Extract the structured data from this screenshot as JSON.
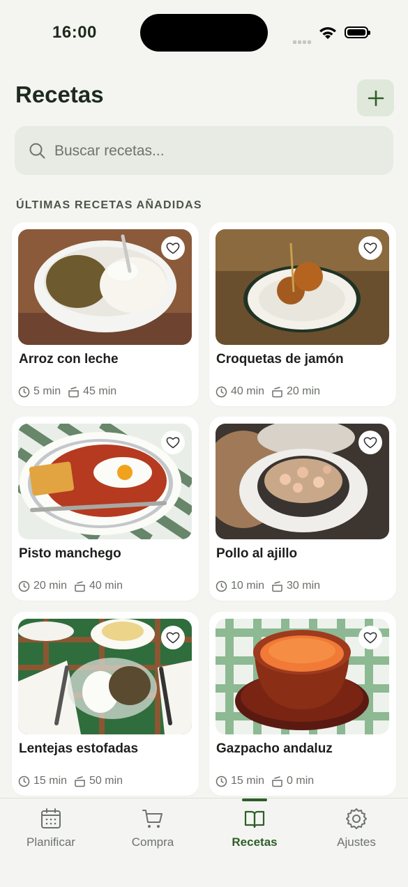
{
  "status": {
    "time": "16:00"
  },
  "header": {
    "title": "Recetas",
    "add_icon": "plus-icon"
  },
  "search": {
    "placeholder": "Buscar recetas...",
    "icon": "search-icon"
  },
  "section_title": "ÚLTIMAS RECETAS AÑADIDAS",
  "recipes": [
    {
      "name": "Arroz con leche",
      "prep": "5 min",
      "cook": "45 min"
    },
    {
      "name": "Croquetas de jamón",
      "prep": "40 min",
      "cook": "20 min"
    },
    {
      "name": "Pisto manchego",
      "prep": "20 min",
      "cook": "40 min"
    },
    {
      "name": "Pollo al ajillo",
      "prep": "10 min",
      "cook": "30 min"
    },
    {
      "name": "Lentejas estofadas",
      "prep": "15 min",
      "cook": "50 min"
    },
    {
      "name": "Gazpacho andaluz",
      "prep": "15 min",
      "cook": "0 min"
    }
  ],
  "tabs": [
    {
      "label": "Planificar",
      "icon": "calendar-icon"
    },
    {
      "label": "Compra",
      "icon": "cart-icon"
    },
    {
      "label": "Recetas",
      "icon": "book-icon",
      "active": true
    },
    {
      "label": "Ajustes",
      "icon": "gear-icon"
    }
  ],
  "colors": {
    "accent": "#2e5e2a",
    "background": "#f4f5f1",
    "card": "#ffffff"
  }
}
